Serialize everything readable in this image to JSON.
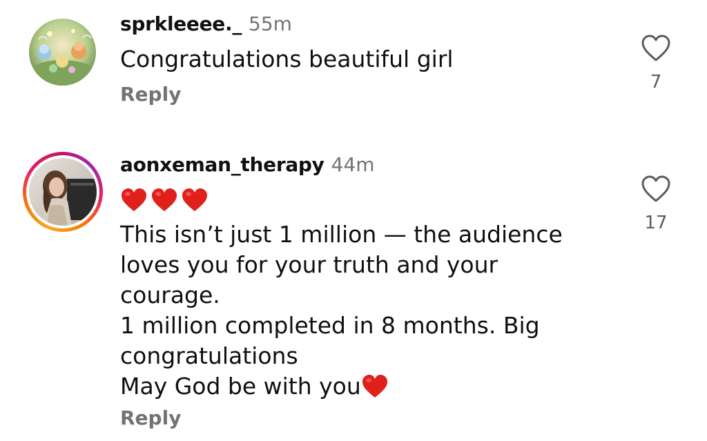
{
  "comments": [
    {
      "username": "sprkleeee._",
      "time": "55m",
      "lines": [
        "Congratulations beautiful girl"
      ],
      "reply_label": "Reply",
      "likes": "7"
    },
    {
      "username": "aonxeman_therapy",
      "time": "44m",
      "lines": [
        "This isn’t just 1 million — the audience",
        "loves you for your truth and your",
        "courage.",
        "1 million completed in 8 months. Big",
        "congratulations",
        "May God be with you"
      ],
      "reply_label": "Reply",
      "likes": "17"
    }
  ],
  "colors": {
    "accent_heart": "#e0201b",
    "muted_text": "#737373",
    "story_ring_start": "#f9a825",
    "story_ring_end": "#c2185b"
  },
  "icons": {
    "like": "heart-outline-icon",
    "emoji": "red-heart-emoji"
  }
}
